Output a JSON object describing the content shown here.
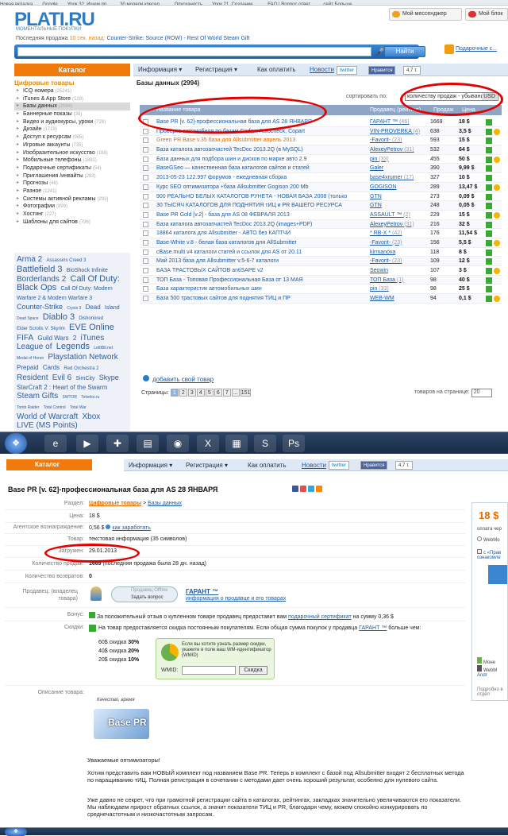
{
  "bookmarks": [
    "Новая вкладка",
    "Google",
    "Урок 32. Ищем пр...",
    "30 модели кресел ...",
    "Опусканость",
    "Урок 21. Создание ...",
    "FAQ | Вопрос ответ...",
    "сейт Больше ..."
  ],
  "site": {
    "logo": "PLATI.RU",
    "tagline": "МОМЕНТАЛЬНЫЕ ПОКУПКИ",
    "messenger_label": "Мой мессенджер",
    "blog_label": "Мой блок",
    "lastsale_prefix": "Последняя продажа",
    "lastsale_time": "10 сек. назад:",
    "lastsale_item": "Counter-Strike: Source (ROW) - Rest Of World Steam Gift",
    "search_button": "Найти",
    "gifts_label": "Подарочные с..."
  },
  "nav": {
    "catalog": "Каталог",
    "info": "Информация ▾",
    "reg": "Регистрация ▾",
    "howpay": "Как оплатить",
    "news": "Новости",
    "twitter": "twitter",
    "fb_like": "Нравится",
    "likes": "4,7 т."
  },
  "sidebar": {
    "head": "Цифровые товары",
    "items": [
      {
        "label": "ICQ номера",
        "count": "(25241)"
      },
      {
        "label": "iTunes & App Store",
        "count": "(128)"
      },
      {
        "label": "Базы данных",
        "count": "(2994)"
      },
      {
        "label": "Баннерные показы",
        "count": "(38)"
      },
      {
        "label": "Видео и аудиокурсы, уроки",
        "count": "(728)"
      },
      {
        "label": "Дизайн",
        "count": "(1719)"
      },
      {
        "label": "Доступ к ресурсам",
        "count": "(985)"
      },
      {
        "label": "Игровые аккаунты",
        "count": "(735)"
      },
      {
        "label": "Изобразительное искусство",
        "count": "(188)"
      },
      {
        "label": "Мобильные телефоны",
        "count": "(1892)"
      },
      {
        "label": "Подарочные сертификаты",
        "count": "(54)"
      },
      {
        "label": "Приглашения /инвайты",
        "count": "(283)"
      },
      {
        "label": "Прогнозы",
        "count": "(46)"
      },
      {
        "label": "Разное",
        "count": "(1241)"
      },
      {
        "label": "Системы активной рекламы",
        "count": "(293)"
      },
      {
        "label": "Фотографии",
        "count": "(899)"
      },
      {
        "label": "Хостинг",
        "count": "(227)"
      },
      {
        "label": "Шаблоны для сайтов",
        "count": "(796)"
      }
    ]
  },
  "tagcloud": [
    {
      "t": "Arma 2",
      "s": 10
    },
    {
      "t": "Assassins Creed 3",
      "s": 6
    },
    {
      "t": "Battlefield 3",
      "s": 11
    },
    {
      "t": "BioShock Infinite",
      "s": 7
    },
    {
      "t": "Borderlands 2",
      "s": 10
    },
    {
      "t": "Call Of Duty:",
      "s": 11
    },
    {
      "t": "Black Ops",
      "s": 11
    },
    {
      "t": "Call Of Duty: Modern",
      "s": 7
    },
    {
      "t": "Warfare 2 & Modern Warfare 3",
      "s": 7
    },
    {
      "t": "Counter-Strike",
      "s": 9
    },
    {
      "t": "Crysis 3",
      "s": 5
    },
    {
      "t": "Dead",
      "s": 8
    },
    {
      "t": "Island",
      "s": 7
    },
    {
      "t": "Dead Space",
      "s": 5
    },
    {
      "t": "Diablo 3",
      "s": 11
    },
    {
      "t": "Dishonored",
      "s": 6
    },
    {
      "t": "Elder Scrolls V: Skyrim",
      "s": 6
    },
    {
      "t": "EVE Online",
      "s": 11
    },
    {
      "t": "FIFA",
      "s": 10
    },
    {
      "t": "Guild Wars",
      "s": 8
    },
    {
      "t": "2",
      "s": 8
    },
    {
      "t": "iTunes",
      "s": 10
    },
    {
      "t": "League of",
      "s": 10
    },
    {
      "t": "Legends",
      "s": 11
    },
    {
      "t": "LetItBit.net",
      "s": 5
    },
    {
      "t": "Medal of Honor",
      "s": 5
    },
    {
      "t": "Playstation Network",
      "s": 10
    },
    {
      "t": "Prepaid",
      "s": 8
    },
    {
      "t": "Cards",
      "s": 8
    },
    {
      "t": "Red Orchestra 2",
      "s": 6
    },
    {
      "t": "Resident",
      "s": 10
    },
    {
      "t": "Evil 6",
      "s": 10
    },
    {
      "t": "SimCity",
      "s": 7
    },
    {
      "t": "Skype",
      "s": 9
    },
    {
      "t": "StarCraft 2 : Heart of the Swarm",
      "s": 8
    },
    {
      "t": "Steam Gifts",
      "s": 10
    },
    {
      "t": "SWTOR",
      "s": 5
    },
    {
      "t": "Telonko.ru",
      "s": 5
    },
    {
      "t": "Tomb Raider",
      "s": 5
    },
    {
      "t": "Total Control",
      "s": 5
    },
    {
      "t": "Total War",
      "s": 5
    },
    {
      "t": "World of Warcraft",
      "s": 10
    },
    {
      "t": "Xbox",
      "s": 10
    },
    {
      "t": "LIVE (MS Points)",
      "s": 10
    }
  ],
  "list": {
    "breadcrumb": "Базы данных (2994)",
    "sort_label": "сортировать по:",
    "sort_value": "количеству продаж - убыванию",
    "currency": "USD",
    "col_name": "Название товара",
    "col_seller": "Продавец (рейтинг)",
    "col_sales": "Продаж",
    "col_price": "Цена",
    "rows": [
      {
        "name": "Base PR [v. 62]-профессиональная база для AS 28 ЯНВАРЯ",
        "seller": "ГАРАНТ ™",
        "rating": "(46)",
        "sales": "1669",
        "price": "18 $",
        "g": false
      },
      {
        "name": "Проверка автомобиля по базам Carfax, Autocheck, Copart",
        "seller": "VIN-PROVERKA",
        "rating": "(4)",
        "sales": "638",
        "price": "3,5 $",
        "g": false
      },
      {
        "name": "Green PR Base v.35 база для Allsubmitter апрель 2013",
        "seller": "-Favorit-",
        "rating": "(23)",
        "sales": "593",
        "price": "15 $",
        "g": true
      },
      {
        "name": "База каталога автозапчастей TecDoc 2013.2Q (в MySQL)",
        "seller": "AlexeyPetrov",
        "rating": "(31)",
        "sales": "532",
        "price": "64 $",
        "g": false
      },
      {
        "name": "База данных для подбора шин и дисков по марке авто 2.9",
        "seller": "pin",
        "rating": "(33)",
        "sales": "455",
        "price": "50 $",
        "g": false
      },
      {
        "name": "BaseGSeo — качественная база каталогов сайтов и статей",
        "seller": "Galer",
        "rating": "",
        "sales": "390",
        "price": "9,99 $",
        "g": false
      },
      {
        "name": "2013-05-23 122.997 форумов - ежедневная сборка",
        "seller": "base4xrumer",
        "rating": "(17)",
        "sales": "327",
        "price": "10 $",
        "g": false
      },
      {
        "name": "Курс SEO оптимизатора +база Allsubmitter Gogison 200 Mb",
        "seller": "GOGISON",
        "rating": "",
        "sales": "289",
        "price": "13,47 $",
        "g": false
      },
      {
        "name": "900 РЕАЛЬНО БЕЛЫХ КАТАЛОГОВ РУНЕТА - НОВАЯ БАЗА 2008 (только",
        "seller": "GTN",
        "rating": "",
        "sales": "273",
        "price": "0,09 $",
        "g": false
      },
      {
        "name": "30 ТЫСЯЧ КАТАЛОГОВ ДЛЯ ПОДНЯТИЯ тИЦ и PR ВАШЕГО РЕСУРСА",
        "seller": "GTN",
        "rating": "",
        "sales": "248",
        "price": "0,05 $",
        "g": false
      },
      {
        "name": "Base PR Gold [v.2] - база для AS 08 ФЕВРАЛЯ 2013",
        "seller": "ASSAULT ™",
        "rating": "(2)",
        "sales": "229",
        "price": "15 $",
        "g": false
      },
      {
        "name": "База каталога автозапчастей TecDoc 2013.2Q (images+PDF)",
        "seller": "AlexeyPetrov",
        "rating": "(31)",
        "sales": "216",
        "price": "32 $",
        "g": false
      },
      {
        "name": "18864 каталога для Allsubmitter - АВТО без КАПТЧИ",
        "seller": "* RB-X *",
        "rating": "(42)",
        "sales": "176",
        "price": "11,54 $",
        "g": false
      },
      {
        "name": "Base-White v.8 - белая база каталогов для AllSubmitter",
        "seller": "-Favorit-",
        "rating": "(23)",
        "sales": "156",
        "price": "5,5 $",
        "g": false
      },
      {
        "name": "cBase.multi v4 каталоги статей и ссылок для AS от 20.11",
        "seller": "kirmanova",
        "rating": "",
        "sales": "118",
        "price": "8 $",
        "g": false
      },
      {
        "name": "Май 2013 база для Allsubmitter v.5-6-7 каталоги",
        "seller": "-Favorit-",
        "rating": "(23)",
        "sales": "109",
        "price": "12 $",
        "g": false
      },
      {
        "name": "БАЗА ТРАСТОВЫХ САЙТОВ antiSAPE v2",
        "seller": "Seowin",
        "rating": "",
        "sales": "107",
        "price": "3 $",
        "g": false
      },
      {
        "name": "ТОП База - Топовая Профессиональная База от 13 МАЯ",
        "seller": "ТОП База",
        "rating": "(1)",
        "sales": "98",
        "price": "40 $",
        "g": false
      },
      {
        "name": "База характеристик автомобильных шин",
        "seller": "pin",
        "rating": "(33)",
        "sales": "98",
        "price": "25 $",
        "g": false
      },
      {
        "name": "База 500 трастовых сайтов для поднятия ТИЦ и ПР",
        "seller": "WEB-WM",
        "rating": "",
        "sales": "94",
        "price": "0,1 $",
        "g": false
      }
    ],
    "add_label": "добавить свой товар",
    "pages_label": "Страницы:",
    "pages": [
      "1",
      "2",
      "3",
      "4",
      "5",
      "6",
      "7",
      "...",
      "151"
    ],
    "perpage_label": "товаров на странице:",
    "perpage_value": "20"
  },
  "product": {
    "title": "Base PR [v. 62]-профессиональная база для AS 28 ЯНВАРЯ",
    "side_price": "18 $",
    "side_pay": "оплата чер",
    "side_wm": "WebMo",
    "side_agree": "с «Прав ознакомле",
    "side_mobile": "Моне",
    "side_webm": "WebM",
    "side_andr": "Andr",
    "side_more": "Подробно в отдел",
    "labels": {
      "section": "Раздел:",
      "price": "Цена:",
      "agent": "Агентское вознаграждение:",
      "goods": "Товар:",
      "uploaded": "Загружен:",
      "qty": "Количество продаж:",
      "returns": "Количество возвратов:",
      "seller": "Продавец: (владелец товара)",
      "bonus": "Бонус:",
      "discounts": "Скидки:",
      "desc": "Описание товара:"
    },
    "section1": "Цифровые товары",
    "section2": "Базы данных",
    "price": "18 $",
    "agent": "0,56 $",
    "agent_link": "как заработать",
    "goods": "текстовая информация (35 символов)",
    "uploaded": "29.01.2013",
    "qty": "1669",
    "qty_note": "(последняя продажа была 28 дн. назад)",
    "returns": "0",
    "seller_status": "Продавец Offline",
    "ask_btn": "Задать вопрос",
    "seller_name": "ГАРАНТ ™",
    "seller_info": "информация о продавце и его товарах",
    "bonus_text": "За положительный отзыв о купленном товаре продавец предоставит вам",
    "bonus_link": "подарочный сертификат",
    "bonus_tail": "на сумму 0,36 $",
    "disc_text": "На товар предоставляется скидка постоянным покупателям. Если общая сумма покупок у продавца",
    "disc_seller": "ГАРАНТ ™",
    "disc_tail": "больше чем:",
    "disc_rows": [
      {
        "amount": "60$",
        "word": "скидка",
        "pct": "30%"
      },
      {
        "amount": "40$",
        "word": "скидка",
        "pct": "20%"
      },
      {
        "amount": "20$",
        "word": "скидка",
        "pct": "10%"
      }
    ],
    "wm_text": "Если вы хотите узнать размер скидки, укажите в поле ваш WM-идентификатор (WMID)",
    "wm_label": "WMID:",
    "wm_btn": "Скидка",
    "desc_img": "Base PR",
    "desc_img_caption": "Качество, время",
    "desc1": "Уважаемые оптимизаторы!",
    "desc2": "Хотим представить вам НОВЫЙ комплект под названием Base PR. Теперь в комплект с базой под Allsubmitter входят 2 бесплатных метода по наращиванию тИЦ. Полная регистрация в сочетании с методами дает очень хороший результат, особенно для нулевого сайта.",
    "desc3": "Уже давно не секрет, что при грамотной регистрации сайта в каталогах, рейтингах, закладках значительно увеличиваются его показатели. Мы наблюдаем прирост обратных ссылок, а значит показатели ТИЦ и PR, благодаря чему, можем спокойно конкурировать по среднечастотным и низкочастотным запросам."
  }
}
